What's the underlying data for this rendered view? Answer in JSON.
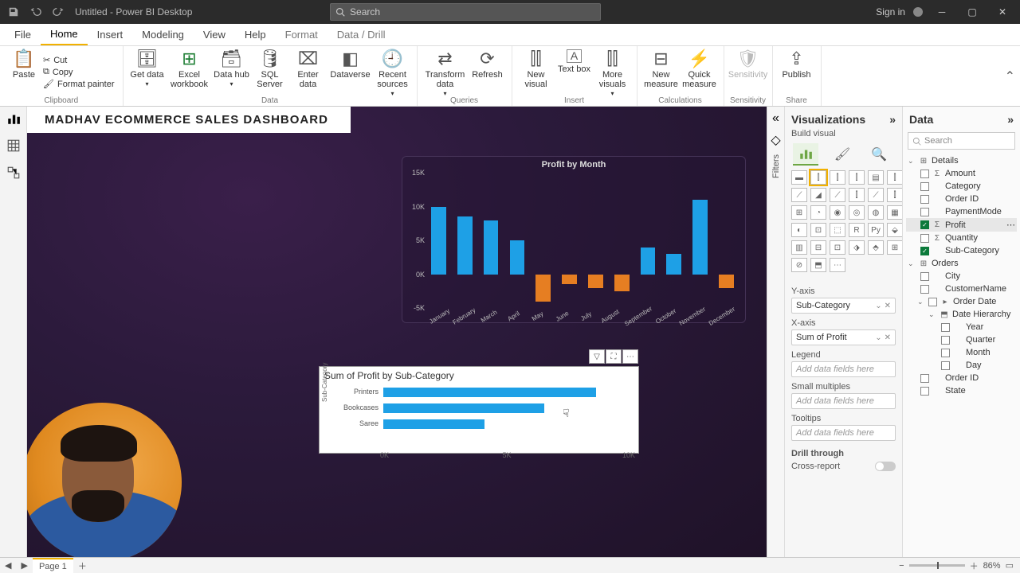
{
  "window": {
    "title": "Untitled - Power BI Desktop",
    "search_placeholder": "Search",
    "signin": "Sign in"
  },
  "menu": {
    "tabs": [
      "File",
      "Home",
      "Insert",
      "Modeling",
      "View",
      "Help",
      "Format",
      "Data / Drill"
    ],
    "active": "Home"
  },
  "ribbon": {
    "clipboard": {
      "paste": "Paste",
      "cut": "Cut",
      "copy": "Copy",
      "format_painter": "Format painter",
      "group": "Clipboard"
    },
    "data": {
      "get": "Get data",
      "excel": "Excel workbook",
      "hub": "Data hub",
      "sql": "SQL Server",
      "enter": "Enter data",
      "dataverse": "Dataverse",
      "recent": "Recent sources",
      "group": "Data"
    },
    "queries": {
      "transform": "Transform data",
      "refresh": "Refresh",
      "group": "Queries"
    },
    "insert": {
      "newvisual": "New visual",
      "textbox": "Text box",
      "more": "More visuals",
      "group": "Insert"
    },
    "calc": {
      "newmeasure": "New measure",
      "quick": "Quick measure",
      "group": "Calculations"
    },
    "sensitivity": {
      "label": "Sensitivity",
      "group": "Sensitivity"
    },
    "share": {
      "publish": "Publish",
      "group": "Share"
    }
  },
  "dashboard_title": "MADHAV ECOMMERCE SALES DASHBOARD",
  "chart_data": [
    {
      "type": "bar",
      "orientation": "vertical",
      "title": "Profit by Month",
      "categories": [
        "January",
        "February",
        "March",
        "April",
        "May",
        "June",
        "July",
        "August",
        "September",
        "October",
        "November",
        "December"
      ],
      "values": [
        10000,
        8500,
        8000,
        5000,
        -4000,
        -1500,
        -2000,
        -2500,
        4000,
        3000,
        11000,
        -2000
      ],
      "ylabel": "",
      "xlabel": "",
      "ylim": [
        -5000,
        15000
      ],
      "yticks": [
        "15K",
        "10K",
        "5K",
        "0K",
        "-5K"
      ],
      "colors": {
        "positive": "#1ea0e6",
        "negative": "#e67e22"
      }
    },
    {
      "type": "bar",
      "orientation": "horizontal",
      "title": "Sum of Profit by Sub-Category",
      "ylabel": "Sub-Category",
      "categories": [
        "Printers",
        "Bookcases",
        "Saree"
      ],
      "values": [
        8600,
        6500,
        4100
      ],
      "xlim": [
        0,
        10000
      ],
      "xticks": [
        "0K",
        "5K",
        "10K"
      ]
    }
  ],
  "hcard_actions": [
    "filter",
    "focus",
    "more"
  ],
  "filters_label": "Filters",
  "visualizations": {
    "title": "Visualizations",
    "subtitle": "Build visual",
    "wells": {
      "yaxis_label": "Y-axis",
      "yaxis_value": "Sub-Category",
      "xaxis_label": "X-axis",
      "xaxis_value": "Sum of Profit",
      "legend_label": "Legend",
      "legend_value": "Add data fields here",
      "small_label": "Small multiples",
      "small_value": "Add data fields here",
      "tooltips_label": "Tooltips",
      "tooltips_value": "Add data fields here",
      "drill_label": "Drill through",
      "cross_label": "Cross-report"
    }
  },
  "data_pane": {
    "title": "Data",
    "search_placeholder": "Search",
    "tables": [
      {
        "name": "Details",
        "expanded": true,
        "fields": [
          {
            "name": "Amount",
            "checked": false,
            "icon": "Σ"
          },
          {
            "name": "Category",
            "checked": false
          },
          {
            "name": "Order ID",
            "checked": false
          },
          {
            "name": "PaymentMode",
            "checked": false
          },
          {
            "name": "Profit",
            "checked": true,
            "icon": "Σ",
            "selected": true
          },
          {
            "name": "Quantity",
            "checked": false,
            "icon": "Σ"
          },
          {
            "name": "Sub-Category",
            "checked": true
          }
        ]
      },
      {
        "name": "Orders",
        "expanded": true,
        "fields": [
          {
            "name": "City",
            "checked": false
          },
          {
            "name": "CustomerName",
            "checked": false
          },
          {
            "name": "Order Date",
            "checked": false,
            "expandable": true,
            "expanded": true,
            "icon": "▸",
            "children": [
              {
                "name": "Date Hierarchy",
                "icon": "⬒",
                "children": [
                  {
                    "name": "Year"
                  },
                  {
                    "name": "Quarter"
                  },
                  {
                    "name": "Month"
                  },
                  {
                    "name": "Day"
                  }
                ]
              }
            ]
          },
          {
            "name": "Order ID",
            "checked": false
          },
          {
            "name": "State",
            "checked": false
          }
        ]
      }
    ]
  },
  "status": {
    "page": "Page 1",
    "zoom": "86%"
  }
}
